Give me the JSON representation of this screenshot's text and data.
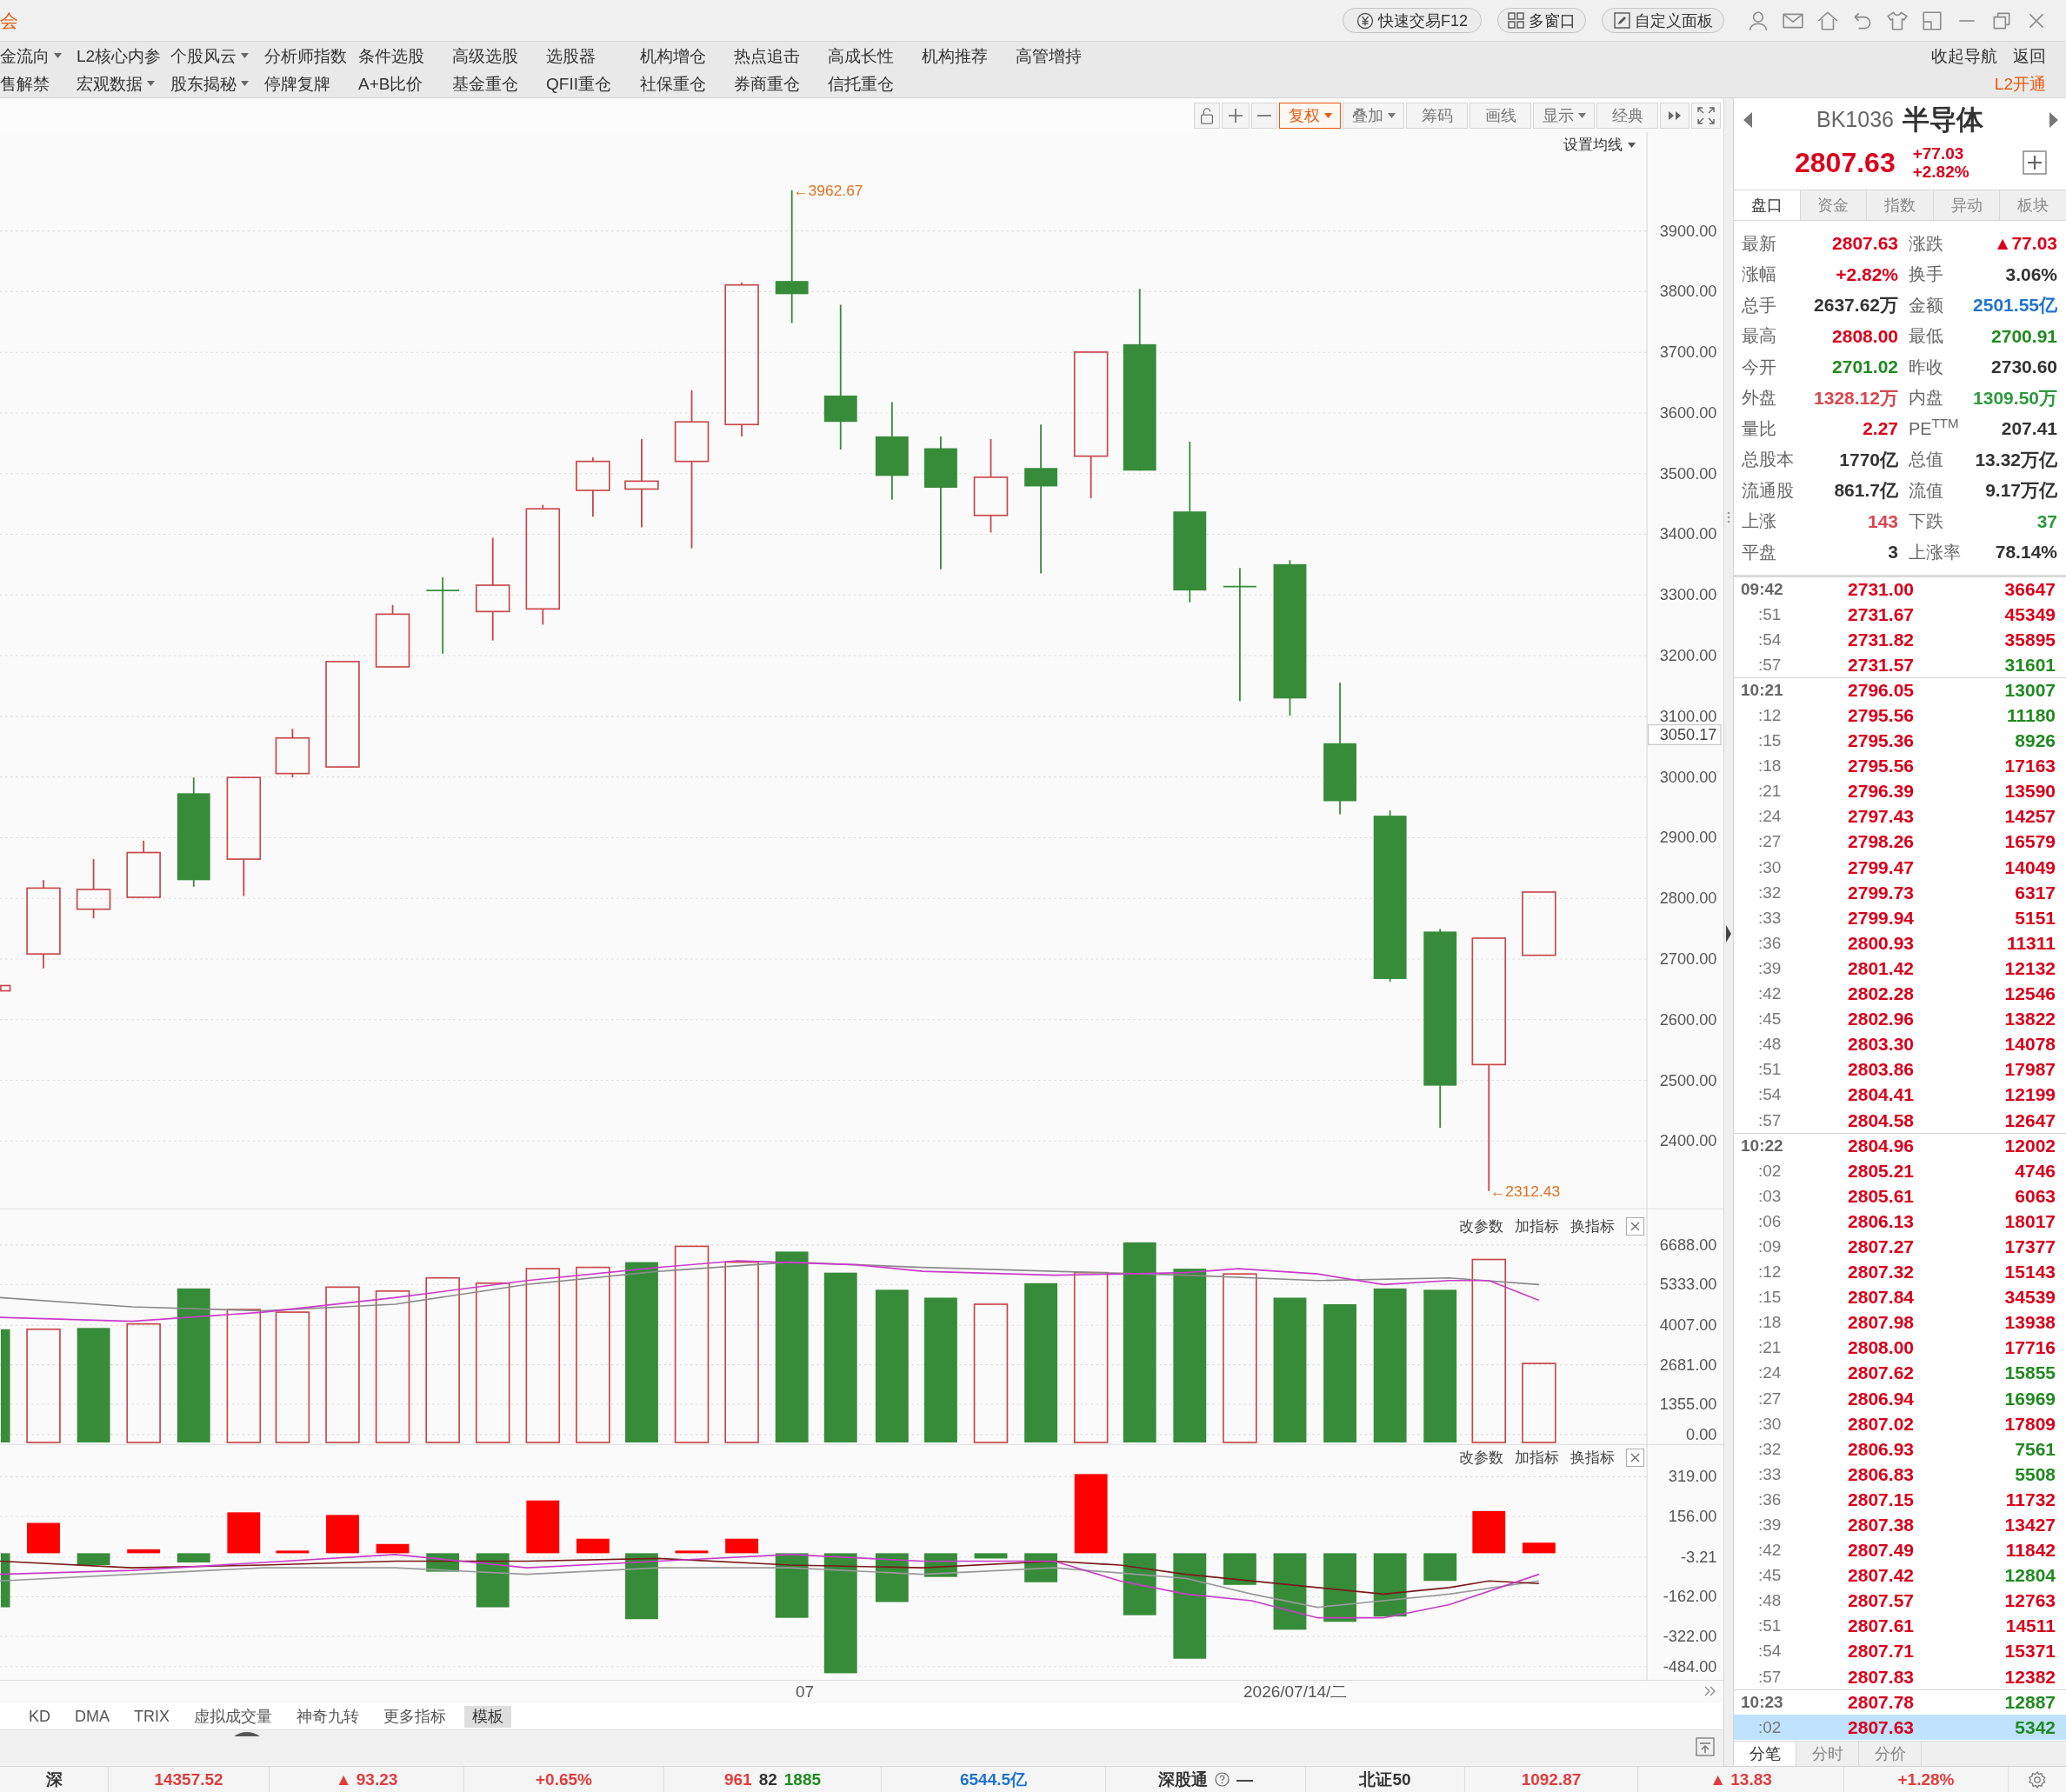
{
  "title_bar": {
    "app_title": "会",
    "buttons": [
      {
        "label": "快速交易F12"
      },
      {
        "label": "多窗口"
      },
      {
        "label": "自定义面板"
      }
    ]
  },
  "nav": {
    "rows": [
      [
        {
          "label": "金流向",
          "dropdown": true
        },
        {
          "label": "L2核心内参",
          "dropdown": false
        },
        {
          "label": "个股风云",
          "dropdown": true
        },
        {
          "label": "分析师指数",
          "dropdown": false
        },
        {
          "label": "条件选股",
          "dropdown": false
        },
        {
          "label": "高级选股",
          "dropdown": false
        },
        {
          "label": "选股器",
          "dropdown": false
        },
        {
          "label": "机构增仓",
          "dropdown": false
        },
        {
          "label": "热点追击",
          "dropdown": false
        },
        {
          "label": "高成长性",
          "dropdown": false
        },
        {
          "label": "机构推荐",
          "dropdown": false
        },
        {
          "label": "高管增持",
          "dropdown": false
        }
      ],
      [
        {
          "label": "售解禁",
          "dropdown": false
        },
        {
          "label": "宏观数据",
          "dropdown": true
        },
        {
          "label": "股东揭秘",
          "dropdown": true
        },
        {
          "label": "停牌复牌",
          "dropdown": false
        },
        {
          "label": "A+B比价",
          "dropdown": false
        },
        {
          "label": "基金重仓",
          "dropdown": false
        },
        {
          "label": "QFII重仓",
          "dropdown": false
        },
        {
          "label": "社保重仓",
          "dropdown": false
        },
        {
          "label": "券商重仓",
          "dropdown": false
        },
        {
          "label": "信托重仓",
          "dropdown": false
        }
      ]
    ],
    "right_links": [
      "收起导航",
      "返回"
    ],
    "upgrade_link": "L2开通"
  },
  "chart_toolbar": {
    "buttons": [
      {
        "label": "复权",
        "dropdown": true,
        "selected": true
      },
      {
        "label": "叠加",
        "dropdown": true,
        "selected": false
      },
      {
        "label": "筹码",
        "dropdown": false,
        "selected": false
      },
      {
        "label": "画线",
        "dropdown": false,
        "selected": false
      },
      {
        "label": "显示",
        "dropdown": true,
        "selected": false
      },
      {
        "label": "经典",
        "dropdown": false,
        "selected": false
      }
    ]
  },
  "price_chart": {
    "ma_button": "设置均线",
    "y_labels": [
      "3900.00",
      "3800.00",
      "3700.00",
      "3600.00",
      "3500.00",
      "3400.00",
      "3300.00",
      "3200.00",
      "3100.00",
      "3000.00",
      "2900.00",
      "2800.00",
      "2700.00",
      "2600.00",
      "2500.00",
      "2400.00"
    ],
    "marker_label": "3050.17",
    "high_label": "←3962.67",
    "low_label": "←2312.43"
  },
  "volume_panel": {
    "actions": [
      "改参数",
      "加指标",
      "换指标"
    ],
    "y_labels": [
      "6688.00",
      "5333.00",
      "4007.00",
      "2681.00",
      "1355.00",
      "0.00"
    ]
  },
  "macd_panel": {
    "actions": [
      "改参数",
      "加指标",
      "换指标"
    ],
    "y_labels": [
      "319.00",
      "156.00",
      "-3.21",
      "-162.00",
      "-322.00",
      "-484.00"
    ]
  },
  "x_axis": {
    "labels": [
      "07",
      "2026/07/14/二"
    ]
  },
  "indicator_tabs": [
    {
      "label": "KD",
      "selected": false
    },
    {
      "label": "DMA",
      "selected": false
    },
    {
      "label": "TRIX",
      "selected": false
    },
    {
      "label": "虚拟成交量",
      "selected": false
    },
    {
      "label": "神奇九转",
      "selected": false
    },
    {
      "label": "更多指标",
      "selected": false
    },
    {
      "label": "模板",
      "selected": true
    }
  ],
  "quote_panel": {
    "code": "BK1036",
    "name": "半导体",
    "price": "2807.63",
    "change": "+77.03",
    "change_pct": "+2.82%",
    "tabs": [
      {
        "label": "盘口",
        "selected": true
      },
      {
        "label": "资金",
        "selected": false
      },
      {
        "label": "指数",
        "selected": false
      },
      {
        "label": "异动",
        "selected": false
      },
      {
        "label": "板块",
        "selected": false
      }
    ],
    "stats": [
      {
        "label": "最新",
        "value": "2807.63",
        "color": "#d9001b"
      },
      {
        "label": "涨跌",
        "value": "▲77.03",
        "color": "#d9001b"
      },
      {
        "label": "涨幅",
        "value": "+2.82%",
        "color": "#d9001b"
      },
      {
        "label": "换手",
        "value": "3.06%",
        "color": "#333333"
      },
      {
        "label": "总手",
        "value": "2637.62万",
        "color": "#333333"
      },
      {
        "label": "金额",
        "value": "2501.55亿",
        "color": "#1e73d2"
      },
      {
        "label": "最高",
        "value": "2808.00",
        "color": "#d9001b"
      },
      {
        "label": "最低",
        "value": "2700.91",
        "color": "#1f8a1f"
      },
      {
        "label": "今开",
        "value": "2701.02",
        "color": "#1f8a1f"
      },
      {
        "label": "昨收",
        "value": "2730.60",
        "color": "#333333"
      },
      {
        "label": "外盘",
        "value": "1328.12万",
        "color": "#d9474f"
      },
      {
        "label": "内盘",
        "value": "1309.50万",
        "color": "#2e9a3e"
      },
      {
        "label": "量比",
        "value": "2.27",
        "color": "#d9001b"
      },
      {
        "label": "PE$^{TTM}$",
        "value": "207.41",
        "color": "#333333"
      },
      {
        "label": "总股本",
        "value": "1770亿",
        "color": "#333333"
      },
      {
        "label": "总值",
        "value": "13.32万亿",
        "color": "#333333"
      },
      {
        "label": "流通股",
        "value": "861.7亿",
        "color": "#333333"
      },
      {
        "label": "流值",
        "value": "9.17万亿",
        "color": "#333333"
      },
      {
        "label": "上涨",
        "value": "143",
        "color": "#d9474f"
      },
      {
        "label": "下跌",
        "value": "37",
        "color": "#2e9a3e"
      },
      {
        "label": "平盘",
        "value": "3",
        "color": "#333333"
      },
      {
        "label": "上涨率",
        "value": "78.14%",
        "color": "#333333"
      }
    ],
    "ticks": [
      {
        "time": "09:42",
        "kind": "minute",
        "price": "2731.00",
        "volume": "36647",
        "color": "#d9001b",
        "selected": false
      },
      {
        "time": ":51",
        "kind": "second",
        "price": "2731.67",
        "volume": "45349",
        "color": "#d9001b",
        "selected": false
      },
      {
        "time": ":54",
        "kind": "second",
        "price": "2731.82",
        "volume": "35895",
        "color": "#d9001b",
        "selected": false
      },
      {
        "time": ":57",
        "kind": "second",
        "price": "2731.57",
        "volume": "31601",
        "color": "#1f8a1f",
        "selected": false
      },
      {
        "time": "10:21",
        "kind": "minute",
        "price": "2796.05",
        "volume": "13007",
        "color": "#1f8a1f",
        "selected": false
      },
      {
        "time": ":12",
        "kind": "second",
        "price": "2795.56",
        "volume": "11180",
        "color": "#1f8a1f",
        "selected": false
      },
      {
        "time": ":15",
        "kind": "second",
        "price": "2795.36",
        "volume": "8926",
        "color": "#1f8a1f",
        "selected": false
      },
      {
        "time": ":18",
        "kind": "second",
        "price": "2795.56",
        "volume": "17163",
        "color": "#d9001b",
        "selected": false
      },
      {
        "time": ":21",
        "kind": "second",
        "price": "2796.39",
        "volume": "13590",
        "color": "#d9001b",
        "selected": false
      },
      {
        "time": ":24",
        "kind": "second",
        "price": "2797.43",
        "volume": "14257",
        "color": "#d9001b",
        "selected": false
      },
      {
        "time": ":27",
        "kind": "second",
        "price": "2798.26",
        "volume": "16579",
        "color": "#d9001b",
        "selected": false
      },
      {
        "time": ":30",
        "kind": "second",
        "price": "2799.47",
        "volume": "14049",
        "color": "#d9001b",
        "selected": false
      },
      {
        "time": ":32",
        "kind": "second",
        "price": "2799.73",
        "volume": "6317",
        "color": "#d9001b",
        "selected": false
      },
      {
        "time": ":33",
        "kind": "second",
        "price": "2799.94",
        "volume": "5151",
        "color": "#d9001b",
        "selected": false
      },
      {
        "time": ":36",
        "kind": "second",
        "price": "2800.93",
        "volume": "11311",
        "color": "#d9001b",
        "selected": false
      },
      {
        "time": ":39",
        "kind": "second",
        "price": "2801.42",
        "volume": "12132",
        "color": "#d9001b",
        "selected": false
      },
      {
        "time": ":42",
        "kind": "second",
        "price": "2802.28",
        "volume": "12546",
        "color": "#d9001b",
        "selected": false
      },
      {
        "time": ":45",
        "kind": "second",
        "price": "2802.96",
        "volume": "13822",
        "color": "#d9001b",
        "selected": false
      },
      {
        "time": ":48",
        "kind": "second",
        "price": "2803.30",
        "volume": "14078",
        "color": "#d9001b",
        "selected": false
      },
      {
        "time": ":51",
        "kind": "second",
        "price": "2803.86",
        "volume": "17987",
        "color": "#d9001b",
        "selected": false
      },
      {
        "time": ":54",
        "kind": "second",
        "price": "2804.41",
        "volume": "12199",
        "color": "#d9001b",
        "selected": false
      },
      {
        "time": ":57",
        "kind": "second",
        "price": "2804.58",
        "volume": "12647",
        "color": "#d9001b",
        "selected": false
      },
      {
        "time": "10:22",
        "kind": "minute",
        "price": "2804.96",
        "volume": "12002",
        "color": "#d9001b",
        "selected": false
      },
      {
        "time": ":02",
        "kind": "second",
        "price": "2805.21",
        "volume": "4746",
        "color": "#d9001b",
        "selected": false
      },
      {
        "time": ":03",
        "kind": "second",
        "price": "2805.61",
        "volume": "6063",
        "color": "#d9001b",
        "selected": false
      },
      {
        "time": ":06",
        "kind": "second",
        "price": "2806.13",
        "volume": "18017",
        "color": "#d9001b",
        "selected": false
      },
      {
        "time": ":09",
        "kind": "second",
        "price": "2807.27",
        "volume": "17377",
        "color": "#d9001b",
        "selected": false
      },
      {
        "time": ":12",
        "kind": "second",
        "price": "2807.32",
        "volume": "15143",
        "color": "#d9001b",
        "selected": false
      },
      {
        "time": ":15",
        "kind": "second",
        "price": "2807.84",
        "volume": "34539",
        "color": "#d9001b",
        "selected": false
      },
      {
        "time": ":18",
        "kind": "second",
        "price": "2807.98",
        "volume": "13938",
        "color": "#d9001b",
        "selected": false
      },
      {
        "time": ":21",
        "kind": "second",
        "price": "2808.00",
        "volume": "17716",
        "color": "#d9001b",
        "selected": false
      },
      {
        "time": ":24",
        "kind": "second",
        "price": "2807.62",
        "volume": "15855",
        "color": "#1f8a1f",
        "selected": false
      },
      {
        "time": ":27",
        "kind": "second",
        "price": "2806.94",
        "volume": "16969",
        "color": "#1f8a1f",
        "selected": false
      },
      {
        "time": ":30",
        "kind": "second",
        "price": "2807.02",
        "volume": "17809",
        "color": "#d9001b",
        "selected": false
      },
      {
        "time": ":32",
        "kind": "second",
        "price": "2806.93",
        "volume": "7561",
        "color": "#1f8a1f",
        "selected": false
      },
      {
        "time": ":33",
        "kind": "second",
        "price": "2806.83",
        "volume": "5508",
        "color": "#1f8a1f",
        "selected": false
      },
      {
        "time": ":36",
        "kind": "second",
        "price": "2807.15",
        "volume": "11732",
        "color": "#d9001b",
        "selected": false
      },
      {
        "time": ":39",
        "kind": "second",
        "price": "2807.38",
        "volume": "13427",
        "color": "#d9001b",
        "selected": false
      },
      {
        "time": ":42",
        "kind": "second",
        "price": "2807.49",
        "volume": "11842",
        "color": "#d9001b",
        "selected": false
      },
      {
        "time": ":45",
        "kind": "second",
        "price": "2807.42",
        "volume": "12804",
        "color": "#1f8a1f",
        "selected": false
      },
      {
        "time": ":48",
        "kind": "second",
        "price": "2807.57",
        "volume": "12763",
        "color": "#d9001b",
        "selected": false
      },
      {
        "time": ":51",
        "kind": "second",
        "price": "2807.61",
        "volume": "14511",
        "color": "#d9001b",
        "selected": false
      },
      {
        "time": ":54",
        "kind": "second",
        "price": "2807.71",
        "volume": "15371",
        "color": "#d9001b",
        "selected": false
      },
      {
        "time": ":57",
        "kind": "second",
        "price": "2807.83",
        "volume": "12382",
        "color": "#d9001b",
        "selected": false
      },
      {
        "time": "10:23",
        "kind": "minute",
        "price": "2807.78",
        "volume": "12887",
        "color": "#1f8a1f",
        "selected": false
      },
      {
        "time": ":02",
        "kind": "second",
        "price": "2807.63",
        "volume": "5342",
        "color": "#1f8a1f",
        "selected": true
      }
    ],
    "bottom_tabs": [
      {
        "label": "分笔",
        "selected": true
      },
      {
        "label": "分时",
        "selected": false
      },
      {
        "label": "分价",
        "selected": false
      }
    ]
  },
  "status_bar": {
    "cells": [
      {
        "parts": [
          {
            "text": "深",
            "color": "#333333"
          }
        ],
        "help": false
      },
      {
        "parts": [
          {
            "text": "14357.52",
            "color": "#e03c3c"
          }
        ],
        "help": false
      },
      {
        "parts": [
          {
            "text": "▲ 93.23",
            "color": "#e03c3c"
          }
        ],
        "help": false
      },
      {
        "parts": [
          {
            "text": "+0.65%",
            "color": "#e03c3c"
          }
        ],
        "help": false
      },
      {
        "parts": [
          {
            "text": "961",
            "color": "#e03c3c"
          },
          {
            "text": "82",
            "color": "#333333"
          },
          {
            "text": "1885",
            "color": "#1f8a1f"
          }
        ],
        "help": false
      },
      {
        "parts": [
          {
            "text": "6544.5亿",
            "color": "#1e73d2"
          }
        ],
        "help": false
      },
      {
        "parts": [
          {
            "text": "深股通",
            "color": "#333333"
          },
          {
            "text": "—",
            "color": "#333333"
          }
        ],
        "help": true
      },
      {
        "parts": [
          {
            "text": "北证50",
            "color": "#333333"
          }
        ],
        "help": false
      },
      {
        "parts": [
          {
            "text": "1092.87",
            "color": "#e03c3c"
          }
        ],
        "help": false
      },
      {
        "parts": [
          {
            "text": "▲ 13.83",
            "color": "#e03c3c"
          }
        ],
        "help": false
      },
      {
        "parts": [
          {
            "text": "+1.28%",
            "color": "#e03c3c"
          }
        ],
        "help": false
      }
    ]
  }
}
